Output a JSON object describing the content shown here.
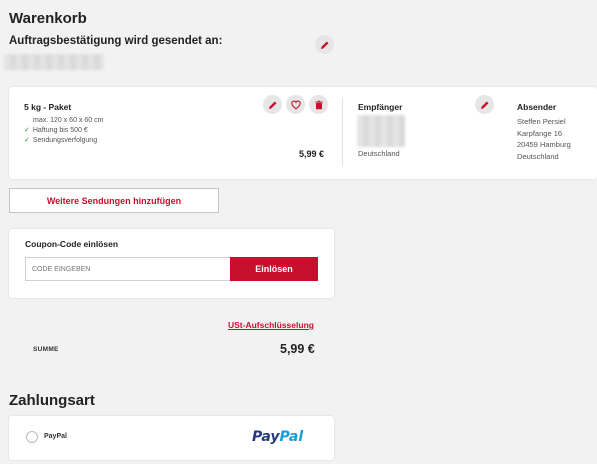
{
  "page": {
    "title": "Warenkorb",
    "confirmation_label": "Auftragsbestätigung wird gesendet an:"
  },
  "shipment": {
    "package_title": "5 kg - Paket",
    "dimensions": "max. 120 x 60 x 60 cm",
    "features": [
      "Haftung bis 500 €",
      "Sendungsverfolgung"
    ],
    "price": "5,99 €",
    "recipient": {
      "heading": "Empfänger",
      "country": "Deutschland"
    },
    "sender": {
      "heading": "Absender",
      "lines": [
        "Steffen Persiel",
        "Karpfange 16",
        "20459 Hamburg",
        "Deutschland"
      ]
    }
  },
  "actions": {
    "add_shipment": "Weitere Sendungen hinzufügen"
  },
  "coupon": {
    "title": "Coupon-Code einlösen",
    "placeholder": "CODE EINGEBEN",
    "button": "Einlösen"
  },
  "summary": {
    "tax_link": "USt-Aufschlüsselung",
    "sum_label": "SUMME",
    "sum_value": "5,99 €"
  },
  "payment": {
    "title": "Zahlungsart",
    "option_label": "PayPal",
    "logo_part1": "Pay",
    "logo_part2": "Pal"
  },
  "colors": {
    "accent": "#c8102e",
    "paypal_dark": "#253b80",
    "paypal_light": "#179bd7"
  },
  "icons": [
    "edit-icon",
    "heart-icon",
    "trash-icon",
    "check-icon",
    "paypal-icon"
  ]
}
